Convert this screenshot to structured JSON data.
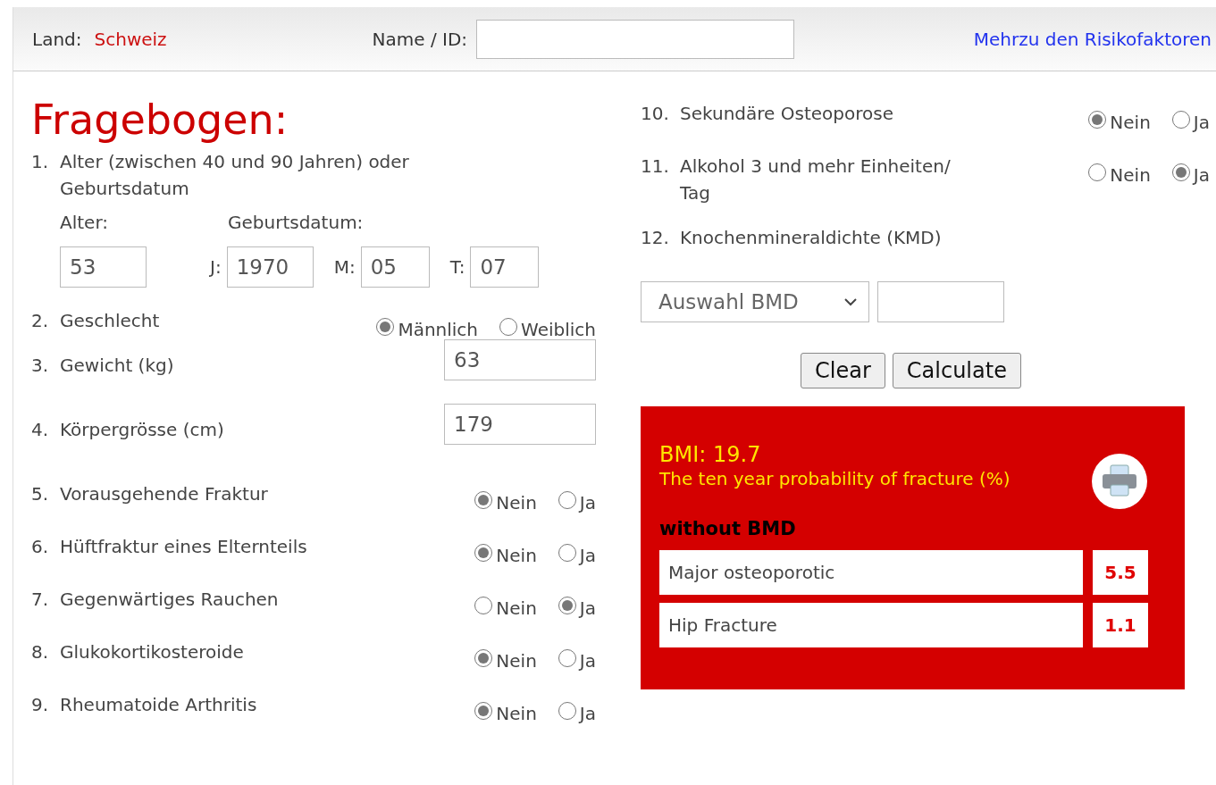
{
  "header": {
    "land_label": "Land:",
    "land_value": "Schweiz",
    "name_label": "Name / ID:",
    "link": "Mehrzu den Risikofaktoren"
  },
  "title": "Fragebogen:",
  "questions_left": [
    {
      "kind": "dates",
      "number": "1.",
      "label": "Alter (zwischen 40 und 90 Jahren) oder Geburtsdatum",
      "age_label": "Alter:",
      "age_value": "53",
      "dob_label": "Geburtsdatum:",
      "parts": [
        {
          "label": "J:",
          "value": "1970"
        },
        {
          "label": "M:",
          "value": "05"
        },
        {
          "label": "T:",
          "value": "07"
        }
      ]
    },
    {
      "kind": "radio",
      "number": "2.",
      "label": "Geschlecht",
      "options": [
        {
          "label": "Männlich",
          "selected": true
        },
        {
          "label": "Weiblich",
          "selected": false
        }
      ]
    },
    {
      "kind": "input",
      "number": "3.",
      "label": "Gewicht (kg)",
      "value": "63"
    },
    {
      "kind": "input",
      "number": "4.",
      "label": "Körpergrösse (cm)",
      "value": "179"
    },
    {
      "kind": "radio",
      "number": "5.",
      "label": "Vorausgehende Fraktur",
      "options": [
        {
          "label": "Nein",
          "selected": true
        },
        {
          "label": "Ja",
          "selected": false
        }
      ]
    },
    {
      "kind": "radio",
      "number": "6.",
      "label": "Hüftfraktur eines Elternteils",
      "options": [
        {
          "label": "Nein",
          "selected": true
        },
        {
          "label": "Ja",
          "selected": false
        }
      ]
    },
    {
      "kind": "radio",
      "number": "7.",
      "label": "Gegenwärtiges Rauchen",
      "options": [
        {
          "label": "Nein",
          "selected": false
        },
        {
          "label": "Ja",
          "selected": true
        }
      ]
    },
    {
      "kind": "radio",
      "number": "8.",
      "label": "Glukokortikosteroide",
      "options": [
        {
          "label": "Nein",
          "selected": true
        },
        {
          "label": "Ja",
          "selected": false
        }
      ]
    },
    {
      "kind": "radio",
      "number": "9.",
      "label": "Rheumatoide Arthritis",
      "options": [
        {
          "label": "Nein",
          "selected": true
        },
        {
          "label": "Ja",
          "selected": false
        }
      ]
    }
  ],
  "questions_right": [
    {
      "kind": "radio",
      "number": "10.",
      "label": "Sekundäre Osteoporose",
      "options": [
        {
          "label": "Nein",
          "selected": true
        },
        {
          "label": "Ja",
          "selected": false
        }
      ]
    },
    {
      "kind": "radio",
      "number": "11.",
      "label": "Alkohol 3 und mehr Einheiten/ Tag",
      "options": [
        {
          "label": "Nein",
          "selected": false
        },
        {
          "label": "Ja",
          "selected": true
        }
      ]
    },
    {
      "kind": "bmd",
      "number": "12.",
      "label": "Knochenmineraldichte (KMD)",
      "select": "Auswahl BMD"
    }
  ],
  "buttons": [
    "Clear",
    "Calculate"
  ],
  "result": {
    "bmi": "BMI: 19.7",
    "subtitle": "The ten year probability of fracture (%)",
    "section": "without BMD",
    "rows": [
      {
        "label": "Major osteoporotic",
        "value": "5.5"
      },
      {
        "label": "Hip Fracture",
        "value": "1.1"
      }
    ]
  }
}
